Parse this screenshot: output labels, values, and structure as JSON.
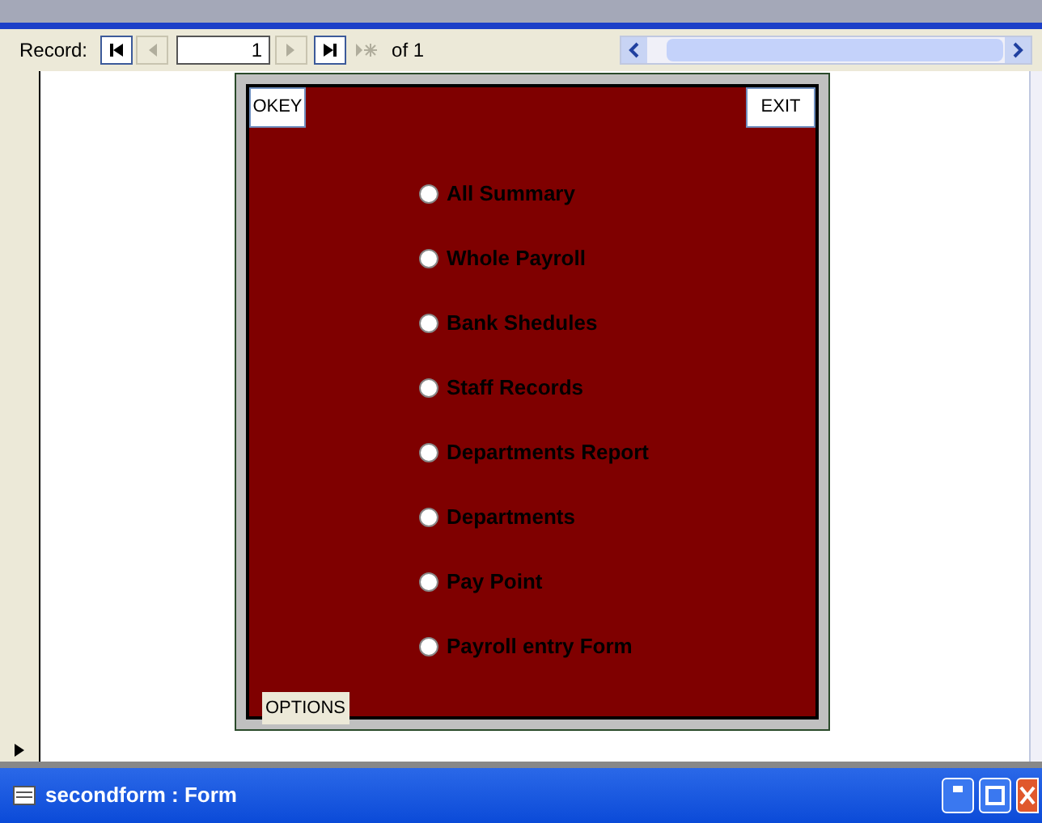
{
  "navigation": {
    "label": "Record:",
    "current": "1",
    "total": "of 1"
  },
  "form": {
    "buttons": [
      "OKEY",
      "EXIT"
    ],
    "group_label": "OPTIONS",
    "options": [
      {
        "label": "All Summary",
        "selected": false
      },
      {
        "label": "Whole Payroll",
        "selected": false
      },
      {
        "label": "Bank Shedules",
        "selected": false
      },
      {
        "label": "Staff Records",
        "selected": false
      },
      {
        "label": "Departments Report",
        "selected": false
      },
      {
        "label": "Departments",
        "selected": false
      },
      {
        "label": "Pay Point",
        "selected": false
      },
      {
        "label": "Payroll entry Form",
        "selected": false
      }
    ]
  },
  "window": {
    "title": "secondform : Form"
  }
}
